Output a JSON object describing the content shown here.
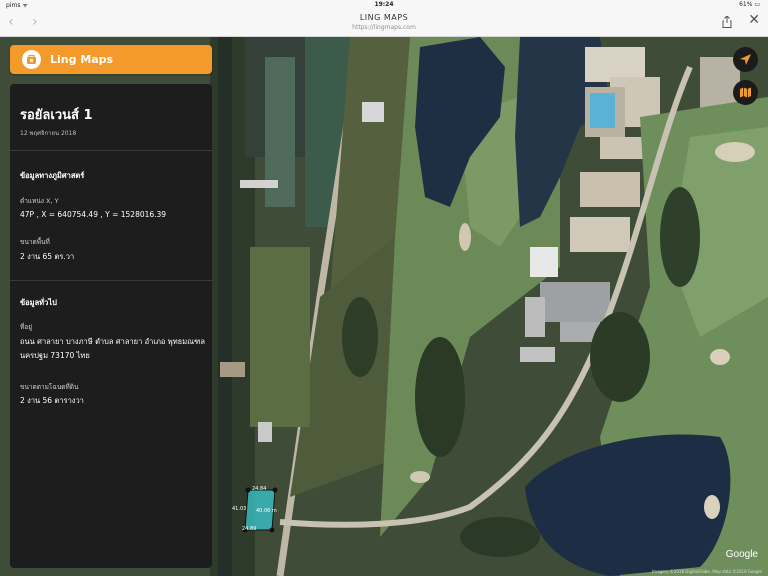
{
  "status_bar": {
    "carrier": "pims ᯤ",
    "time": "19:24",
    "battery": "61% ▭"
  },
  "browser": {
    "title": "LING MAPS",
    "url": "https://lingmaps.com",
    "back": "‹",
    "forward": "›",
    "close": "✕"
  },
  "brand": {
    "name": "Ling Maps",
    "color": "#f39a2b"
  },
  "panel": {
    "title": "รอยัลเวนส์ 1",
    "date": "12 พฤศจิกายน 2018",
    "geo_section": "ข้อมูลทางภูมิศาสตร์",
    "position_label": "ตำแหน่ง X, Y",
    "position_value": "47P , X = 640754.49 , Y = 1528016.39",
    "area_label": "ขนาดพื้นที่",
    "area_value": "2 งาน 65 ตร.วา",
    "general_section": "ข้อมูลทั่วไป",
    "address_label": "ที่อยู่",
    "address_value": "ถนน ศาลายา บางภาษี ตำบล ศาลายา อำเภอ พุทธมณฑล นครปฐม 73170 ไทย",
    "title_deed_label": "ขนาดตามโฉนดที่ดิน",
    "title_deed_value": "2 งาน 56 ตารางวา"
  },
  "map_buttons": {
    "locate_icon": "navigation-arrow-icon",
    "layers_icon": "map-layers-icon"
  },
  "parcel_labels": {
    "top": "24.84",
    "left": "41.03",
    "right": "40.06 m",
    "bottom": "24.89"
  },
  "map": {
    "watermark": "Google",
    "attribution": "Imagery ©2018 DigitalGlobe, Map data ©2018 Google"
  }
}
